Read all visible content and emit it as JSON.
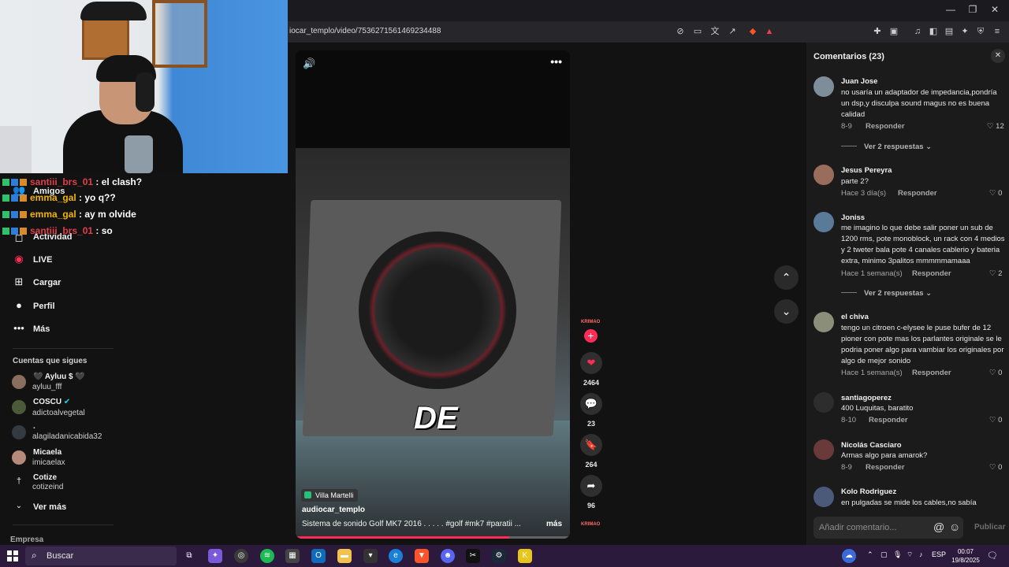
{
  "browser": {
    "url": "iocar_templo/video/7536271561469234488"
  },
  "chat": [
    {
      "user": "santiii_brs_01",
      "message": ": el clash?",
      "color": "#e0404b"
    },
    {
      "user": "emma_gal",
      "message": ": yo q??",
      "color": "#f1b400"
    },
    {
      "user": "emma_gal",
      "message": ": ay m olvide",
      "color": "#f1b400"
    },
    {
      "user": "santiii_brs_01",
      "message": ": so",
      "color": "#e0404b"
    }
  ],
  "sidebar": {
    "nav": [
      {
        "label": "Amigos",
        "icon": "friends-icon"
      },
      {
        "label": "Actividad",
        "icon": "activity-icon"
      },
      {
        "label": "LIVE",
        "icon": "live-icon"
      },
      {
        "label": "Cargar",
        "icon": "upload-icon"
      },
      {
        "label": "Perfil",
        "icon": "profile-icon"
      },
      {
        "label": "Más",
        "icon": "more-icon"
      }
    ],
    "following_title": "Cuentas que sigues",
    "accounts": [
      {
        "name": "🖤 Ayluu $ 🖤",
        "handle": "ayluu_fff"
      },
      {
        "name": "COSCU",
        "handle": "adictoalvegetal"
      },
      {
        "name": ".",
        "handle": "alagiladanicabida32"
      },
      {
        "name": "Micaela",
        "handle": "imicaelax"
      },
      {
        "name": "Cotize",
        "handle": "cotizeind"
      }
    ],
    "see_more": "Ver más",
    "footer": "Empresa"
  },
  "video": {
    "caption_overlay": "DE",
    "location": "Villa Martelli",
    "username": "audiocar_templo",
    "description": "Sistema de sonido Golf MK7 2016  . . . . . #golf  #mk7  #paratii  ...",
    "more_label": "más",
    "progress": 0.78,
    "accent": "#ff2c55"
  },
  "actions": {
    "likes": "2464",
    "comments": "23",
    "saves": "264",
    "shares": "96"
  },
  "comments_panel": {
    "title": "Comentarios (23)",
    "reply_label": "Responder",
    "items": [
      {
        "name": "Juan Jose",
        "text": "no usaría un adaptador de impedancia,pondría un dsp,y disculpa sound magus no es buena calidad",
        "time": "8-9",
        "likes": "12",
        "more": "Ver 2 respuestas"
      },
      {
        "name": "Jesus Pereyra",
        "text": "parte 2?",
        "time": "Hace 3 día(s)",
        "likes": "0"
      },
      {
        "name": "Joniss",
        "text": "me imagino lo que debe salir poner un sub de 1200 rms, pote monoblock, un rack con 4 medios y 2 tweter bala pote 4 canales cablerio y bateria extra, minimo 3palitos mmmmmamaaa",
        "time": "Hace 1 semana(s)",
        "likes": "2",
        "more": "Ver 2 respuestas"
      },
      {
        "name": "el chiva",
        "text": "tengo un citroen c-elysee le puse bufer de 12 pioner con pote mas los parlantes originale se le podria poner algo para vambiar los originales por algo de mejor sonido",
        "time": "Hace 1 semana(s)",
        "likes": "0"
      },
      {
        "name": "santiagoperez",
        "text": "400 Luquitas, baratito",
        "time": "8-10",
        "likes": "0"
      },
      {
        "name": "Nicolás Casciaro",
        "text": "Armas algo para amarok?",
        "time": "8-9",
        "likes": "0"
      },
      {
        "name": "Kolo Rodriguez",
        "text": "en pulgadas se mide los cables,no sabía",
        "time": "",
        "likes": ""
      }
    ],
    "input_placeholder": "Añadir comentario...",
    "publish_label": "Publicar"
  },
  "taskbar": {
    "search_label": "Buscar",
    "lang": "ESP",
    "time": "00:07",
    "date": "19/8/2025",
    "notification_count": "2"
  }
}
